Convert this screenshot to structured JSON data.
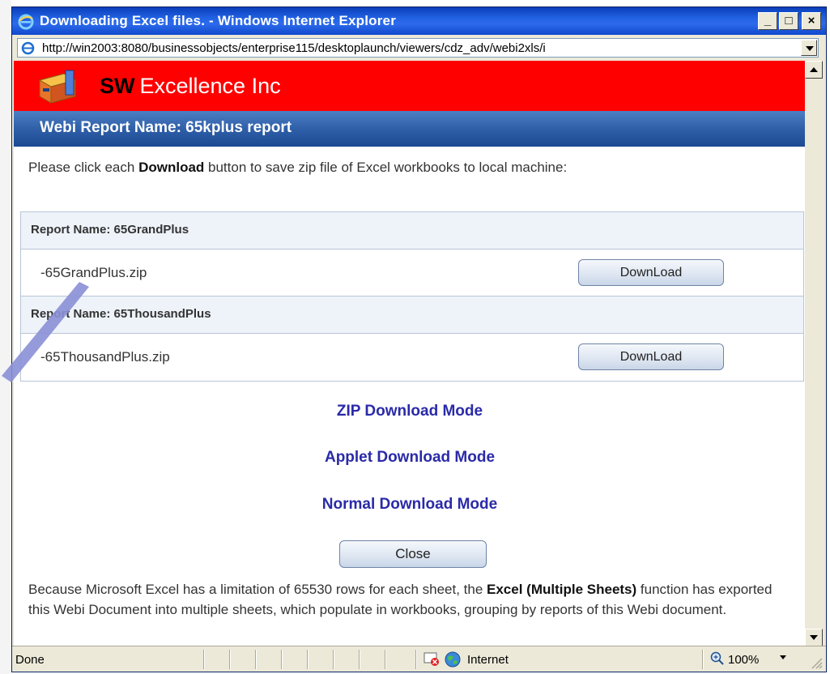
{
  "window": {
    "title": "Downloading Excel files. - Windows Internet Explorer",
    "address": "http://win2003:8080/businessobjects/enterprise115/desktoplaunch/viewers/cdz_adv/webi2xls/i"
  },
  "page": {
    "brand_abbr": "SW",
    "brand_name": "Excellence Inc",
    "report_title": "Webi Report Name: 65kplus report",
    "instruction_pre": "Please click each ",
    "instruction_bold": "Download",
    "instruction_post": " button to save zip file of Excel workbooks to local machine:",
    "reports": [
      {
        "name": "Report Name: 65GrandPlus",
        "file": "-65GrandPlus.zip",
        "button": "DownLoad"
      },
      {
        "name": "Report Name: 65ThousandPlus",
        "file": "-65ThousandPlus.zip",
        "button": "DownLoad"
      }
    ],
    "modes": [
      "ZIP Download Mode",
      "Applet Download Mode",
      "Normal Download Mode"
    ],
    "close_label": "Close",
    "note_pre": "Because Microsoft Excel has a limitation of 65530 rows for each sheet, the ",
    "note_bold": "Excel (Multiple Sheets)",
    "note_post": " function has exported this Webi Document into multiple sheets, which populate in workbooks, grouping by reports of this Webi document."
  },
  "status": {
    "text": "Done",
    "zone": "Internet",
    "zoom": "100%"
  },
  "colors": {
    "brand_bar": "#ff0000",
    "header_blue": "#2f5fa8",
    "link": "#2a2aa8"
  }
}
